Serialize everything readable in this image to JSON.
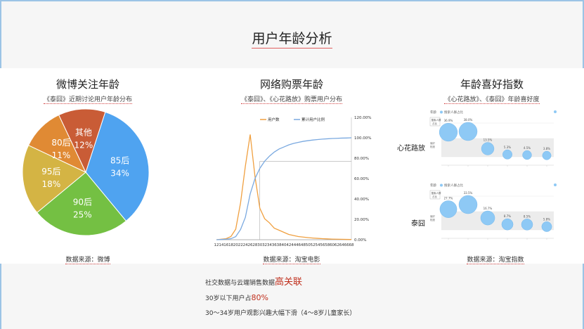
{
  "page": {
    "title": "用户年龄分析",
    "bottom_line1_prefix": "社交数据与云端销售数据",
    "bottom_line1_highlight": "高关联",
    "bottom_line2_prefix": "30岁以下用户占",
    "bottom_line2_highlight": "80%",
    "bottom_line3": "30～34岁用户观影兴趣大幅下滑（4～8岁儿童家长）"
  },
  "left": {
    "title": "微博关注年龄",
    "subtitle": "《泰囧》近期讨论用户年龄分布",
    "source": "数据来源：微博"
  },
  "middle": {
    "title": "网络购票年龄",
    "subtitle": "《泰囧》、《心花路放》购票用户分布",
    "source": "数据来源：淘宝电影"
  },
  "right": {
    "title": "年龄喜好指数",
    "subtitle": "《心花路放》、《泰囧》年龄喜好度",
    "source": "数据来源：淘宝指数",
    "chart1_label": "心花路放",
    "chart2_label": "泰囧"
  },
  "chart_data": [
    {
      "type": "pie",
      "slices": [
        {
          "label": "85后",
          "value": 34,
          "text": "34%",
          "color": "#4fa3f0"
        },
        {
          "label": "90后",
          "value": 25,
          "text": "25%",
          "color": "#74c043"
        },
        {
          "label": "95后",
          "value": 18,
          "text": "18%",
          "color": "#d4b444"
        },
        {
          "label": "80后",
          "value": 11,
          "text": "11%",
          "color": "#e08a34"
        },
        {
          "label": "其他",
          "value": 12,
          "text": "12%",
          "color": "#c95c36"
        }
      ]
    },
    {
      "type": "line",
      "legend": [
        "用户数",
        "累计用户比例"
      ],
      "x": [
        12,
        14,
        16,
        18,
        20,
        22,
        24,
        26,
        28,
        30,
        32,
        34,
        36,
        38,
        40,
        42,
        44,
        46,
        48,
        50,
        52,
        54,
        56,
        58,
        60,
        62,
        64,
        66,
        68
      ],
      "x_tick_labels": [
        "12",
        "14",
        "16",
        "18",
        "20",
        "22",
        "24",
        "26",
        "28",
        "30",
        "32",
        "34",
        "36",
        "38",
        "40",
        "42",
        "44",
        "46",
        "48",
        "50",
        "52",
        "54",
        "56",
        "58",
        "60",
        "62",
        "64",
        "66",
        "68"
      ],
      "y2_tick_labels": [
        "0.00%",
        "20.00%",
        "40.00%",
        "60.00%",
        "80.00%",
        "100.00%",
        "120.00%"
      ],
      "y2lim": [
        0,
        120
      ],
      "series": [
        {
          "name": "用户数",
          "color": "#f0a040",
          "values": [
            0,
            0.5,
            1,
            3,
            10,
            35,
            70,
            100,
            60,
            30,
            20,
            16,
            11,
            9,
            7,
            5,
            4,
            3,
            2.5,
            2,
            1.6,
            1.3,
            1,
            0.8,
            0.6,
            0.5,
            0.4,
            0.3,
            0.2
          ]
        },
        {
          "name": "累计用户比例",
          "color": "#7aa9e0",
          "values": [
            0,
            0.2,
            0.5,
            1,
            3,
            10,
            22,
            45,
            60,
            70,
            77,
            82,
            86,
            89,
            91,
            93,
            94.5,
            95.5,
            96.5,
            97.2,
            97.8,
            98.3,
            98.7,
            99,
            99.3,
            99.5,
            99.7,
            99.8,
            100
          ]
        }
      ],
      "annotation": {
        "x": 30,
        "y": 77
      }
    },
    {
      "type": "scatter",
      "name": "心花路放",
      "legend": [
        "搜索人群占比"
      ],
      "header": "年龄",
      "badge": [
        "搜索人群",
        "占比"
      ],
      "side_label": [
        "偏好",
        "程度"
      ],
      "points": [
        {
          "x": 1,
          "value_label": "36.9%",
          "size": 36.9
        },
        {
          "x": 2,
          "value_label": "38.0%",
          "size": 38.0
        },
        {
          "x": 3,
          "value_label": "13.5%",
          "size": 13.5
        },
        {
          "x": 4,
          "value_label": "5.3%",
          "size": 5.3
        },
        {
          "x": 5,
          "value_label": "4.5%",
          "size": 4.5
        },
        {
          "x": 6,
          "value_label": "3.8%",
          "size": 3.8
        }
      ]
    },
    {
      "type": "scatter",
      "name": "泰囧",
      "legend": [
        "搜索人群占比"
      ],
      "header": "年龄",
      "badge": [
        "搜索人群",
        "占比"
      ],
      "side_label": [
        "偏好",
        "程度"
      ],
      "points": [
        {
          "x": 1,
          "value_label": "27.7%",
          "size": 27.7
        },
        {
          "x": 2,
          "value_label": "33.5%",
          "size": 33.5
        },
        {
          "x": 3,
          "value_label": "16.7%",
          "size": 16.7
        },
        {
          "x": 4,
          "value_label": "8.7%",
          "size": 8.7
        },
        {
          "x": 5,
          "value_label": "8.5%",
          "size": 8.5
        },
        {
          "x": 6,
          "value_label": "5.8%",
          "size": 5.8
        }
      ]
    }
  ]
}
